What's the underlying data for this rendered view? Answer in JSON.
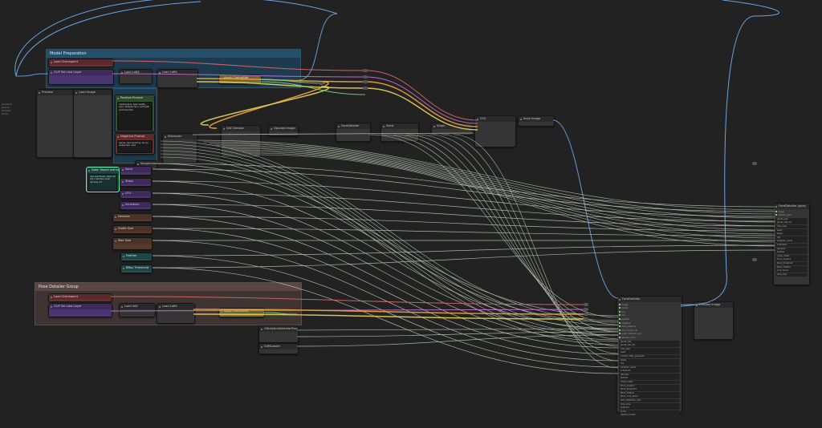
{
  "side_panel": {
    "lines": [
      "ComfyUI",
      "Queue",
      "Prompt",
      "Extra"
    ]
  },
  "groups": {
    "model_group": {
      "title": "Model Preparation",
      "color": "#1f3f55"
    },
    "pose_group": {
      "title": "Pose Detailer Group",
      "color": "#4a3a3a"
    }
  },
  "nodes": {
    "ckpt_top": {
      "title": "Load Checkpoint",
      "rows": [
        "ckpt_name",
        "realisticVision_v51.safetensors"
      ]
    },
    "clip_top": {
      "title": "CLIP Set Last Layer",
      "rows": [
        "stop_at_clip_layer",
        "-2"
      ]
    },
    "vae_top": {
      "title": "Load VAE",
      "rows": [
        "vae_name"
      ]
    },
    "lora_a": {
      "title": "Load LoRA",
      "rows": [
        "model",
        "clip",
        "strength_model",
        "strength_clip"
      ]
    },
    "lora_b": {
      "title": "Load LoRA",
      "rows": [
        "model",
        "clip",
        "strength_model"
      ]
    },
    "apply_cn": {
      "title": "Apply ControlNet",
      "rows": [
        "conditioning",
        "control_net",
        "image",
        "strength"
      ]
    },
    "preview_left": {
      "title": "Preview",
      "rows": [
        "images"
      ]
    },
    "preview_left2": {
      "title": "Load Image",
      "rows": [
        "image"
      ]
    },
    "pos_prompt": {
      "title": "Positive Prompt",
      "text": "masterpiece, best quality, 1girl, detailed face, soft light, portrait photo"
    },
    "neg_prompt": {
      "title": "Negative Prompt",
      "text": "lowres, bad anatomy, blurry, watermark, text"
    },
    "note": {
      "title": "Note: Model settings",
      "text": "Use seed fixed. steps 20 cfg 7 sampler euler denoise 0.5"
    },
    "ksampler_a": {
      "title": "KSampler",
      "rows": [
        "model",
        "positive",
        "negative",
        "latent_image",
        "seed",
        "steps",
        "cfg"
      ]
    },
    "vae_decode": {
      "title": "VAE Decode",
      "rows": [
        "samples",
        "vae"
      ]
    },
    "upscale": {
      "title": "Upscale Image",
      "rows": [
        "image",
        "upscale_method",
        "scale_by"
      ]
    },
    "detailer_mid": {
      "title": "FaceDetailer",
      "rows": [
        "image",
        "model",
        "clip",
        "vae",
        "positive",
        "negative",
        "bbox_detector"
      ]
    },
    "save_mid": {
      "title": "Save Image",
      "rows": [
        "images"
      ]
    },
    "seed": {
      "title": "Seed",
      "rows": [
        "seed"
      ]
    },
    "steps": {
      "title": "Steps",
      "rows": [
        "INT"
      ]
    },
    "cfg": {
      "title": "CFG",
      "rows": [
        "FLOAT"
      ]
    },
    "sampler": {
      "title": "Sampler",
      "rows": [
        "sampler_name"
      ]
    },
    "scheduler": {
      "title": "Scheduler",
      "rows": [
        "scheduler"
      ]
    },
    "denoise": {
      "title": "Denoise",
      "rows": [
        "FLOAT"
      ]
    },
    "guide": {
      "title": "Guide Size",
      "rows": [
        "guide_size"
      ]
    },
    "max": {
      "title": "Max Size",
      "rows": [
        "max_size"
      ]
    },
    "feather": {
      "title": "Feather",
      "rows": [
        "feather"
      ]
    },
    "bbox_thresh": {
      "title": "BBox Threshold",
      "rows": [
        "value"
      ]
    },
    "crop": {
      "title": "Crop Factor",
      "rows": [
        "value"
      ]
    },
    "ckpt_bot": {
      "title": "Load Checkpoint",
      "rows": [
        "ckpt_name",
        "realisticVision_v51.safetensors"
      ]
    },
    "clip_bot": {
      "title": "CLIP Set Last Layer",
      "rows": [
        "stop_at_clip_layer"
      ]
    },
    "vae_bot": {
      "title": "Load VAE",
      "rows": [
        "vae_name"
      ]
    },
    "lora_bot": {
      "title": "Load LoRA",
      "rows": [
        "model",
        "clip",
        "strength"
      ]
    },
    "cn_bot": {
      "title": "Apply ControlNet",
      "rows": [
        "conditioning",
        "control_net"
      ]
    },
    "detector_a": {
      "title": "UltralyticsDetectorProvider",
      "rows": [
        "model_name",
        "face_yolov8m.pt"
      ]
    },
    "detector_b": {
      "title": "SAMLoader",
      "rows": [
        "model_name",
        "sam_vit_b_01ec64.pth"
      ]
    },
    "face_detailer": {
      "title": "FaceDetailer",
      "rows": [
        "image",
        "model",
        "clip",
        "vae",
        "positive",
        "negative",
        "bbox_detector",
        "sam_model_opt",
        "segm_detector_opt",
        "detailer_hook",
        "guide_size",
        "guide_size_for",
        "max_size",
        "seed",
        "control_after_generate",
        "steps",
        "cfg",
        "sampler_name",
        "scheduler",
        "denoise",
        "feather",
        "noise_mask",
        "force_inpaint",
        "bbox_threshold",
        "bbox_dilation",
        "bbox_crop_factor",
        "sam_detection_hint",
        "drop_size",
        "wildcard",
        "cycle",
        "inpaint_model"
      ]
    },
    "preview_out": {
      "title": "Preview Image",
      "rows": [
        "images"
      ]
    },
    "right_node": {
      "title": "FaceDetailer (pipe)",
      "rows": [
        "image",
        "detailer_pipe",
        "guide_size",
        "guide_size_for",
        "max_size",
        "seed",
        "steps",
        "cfg",
        "sampler_name",
        "scheduler",
        "denoise",
        "feather",
        "noise_mask",
        "force_inpaint",
        "bbox_threshold",
        "bbox_dilation",
        "crop_factor",
        "drop_size"
      ]
    }
  }
}
